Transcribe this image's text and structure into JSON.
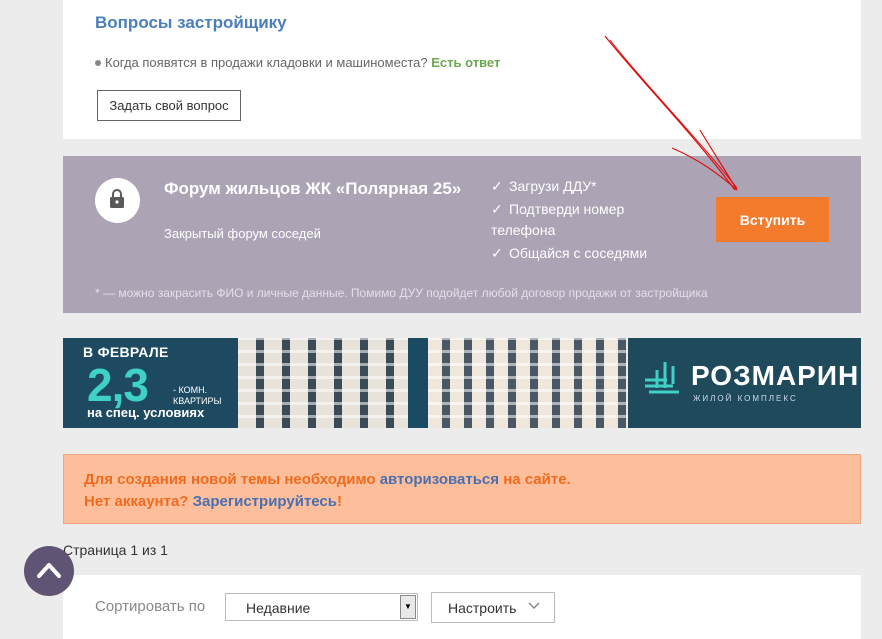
{
  "developer_questions": {
    "title": "Вопросы застройщику",
    "question": "Когда появятся в продажи кладовки и машиноместа?",
    "answer_link": "Есть ответ",
    "ask_button": "Задать свой вопрос"
  },
  "forum": {
    "title": "Форум жильцов ЖК «Полярная 25»",
    "subtitle": "Закрытый форум соседей",
    "benefits": [
      "Загрузи ДДУ*",
      "Подтверди номер телефона",
      "Общайся с соседями"
    ],
    "join_button": "Вступить",
    "footnote": "* — можно закрасить ФИО и личные данные. Помимо ДУУ подойдет любой договор продажи от застройщика",
    "colors": {
      "panel": "#aca3b5",
      "button": "#f47a2c"
    },
    "icon": "lock-icon"
  },
  "banner": {
    "top_text": "В ФЕВРАЛЕ",
    "number": "2,3",
    "small_text": "- КОМН. КВАРТИРЫ",
    "bottom_text": "на спец. условиях",
    "brand": "РОЗМАРИН",
    "brand_sub": "ЖИЛОЙ КОМПЛЕКС"
  },
  "notice": {
    "line1_pre": "Для создания новой темы необходимо ",
    "line1_link": "авторизоваться",
    "line1_post": " на сайте.",
    "line2_pre": "Нет аккаунта? ",
    "line2_link": "Зарегистрируйтесь",
    "line2_post": "!"
  },
  "pager": {
    "text": "Страница 1 из 1"
  },
  "sort": {
    "label": "Сортировать по",
    "selected": "Недавние",
    "config_button": "Настроить"
  },
  "scroll_up": {
    "icon": "chevron-up-icon"
  }
}
